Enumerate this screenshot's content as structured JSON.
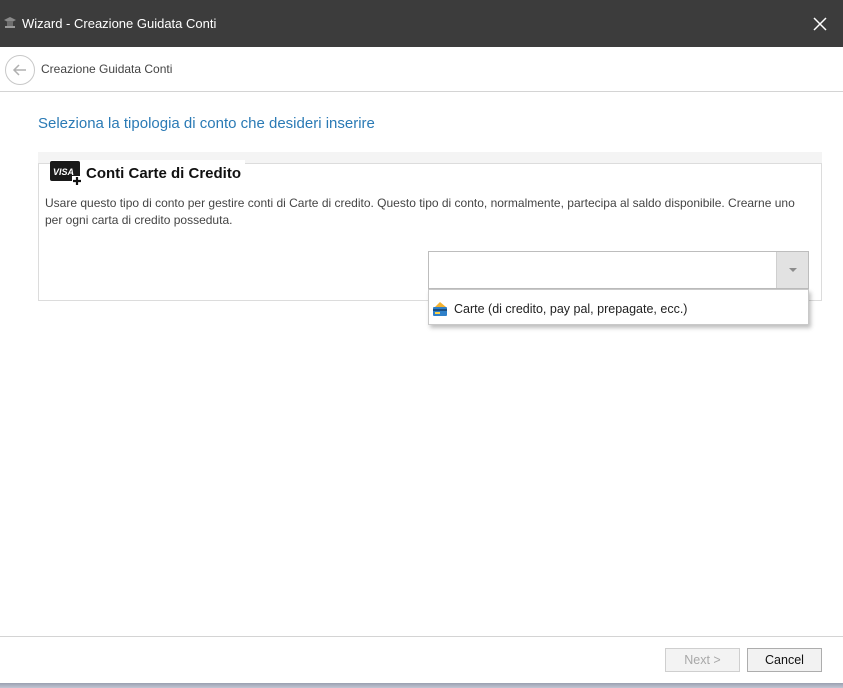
{
  "window": {
    "title": "Wizard - Creazione Guidata Conti",
    "icon": "wizard-hat-icon"
  },
  "navbar": {
    "breadcrumb": "Creazione Guidata Conti",
    "back_icon": "back-arrow-icon"
  },
  "main": {
    "heading": "Seleziona la tipologia di conto che desideri inserire",
    "group": {
      "title": "Conti Carte di Credito",
      "badge_text": "VISA",
      "description": "Usare questo tipo di conto per gestire conti di Carte di credito. Questo tipo di conto, normalmente, partecipa al saldo disponibile. Crearne uno per ogni carta di credito posseduta."
    },
    "combo": {
      "value": "",
      "options": [
        {
          "label": "Carte (di credito, pay pal, prepagate, ecc.)",
          "icon": "credit-card-icon"
        }
      ]
    }
  },
  "footer": {
    "next_label": "Next >",
    "cancel_label": "Cancel"
  },
  "colors": {
    "titlebar": "#3c3c3c",
    "heading": "#2a7ab5"
  }
}
